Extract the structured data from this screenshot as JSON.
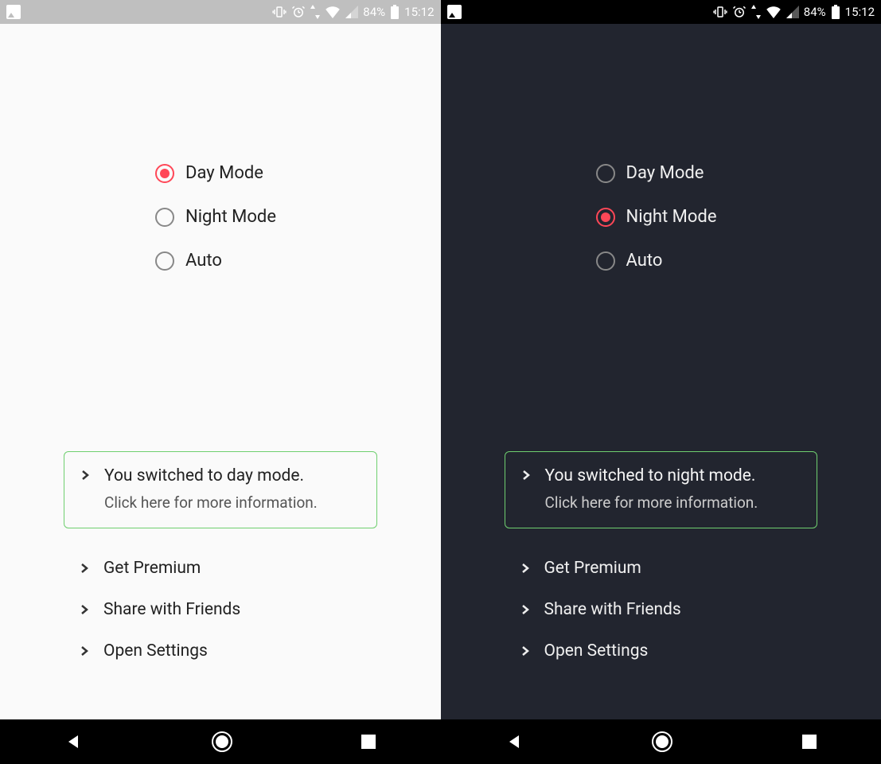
{
  "status": {
    "battery_pct": "84%",
    "time": "15:12"
  },
  "modes": {
    "day": "Day Mode",
    "night": "Night Mode",
    "auto": "Auto"
  },
  "notice": {
    "day_line1": "You switched to day mode.",
    "night_line1": "You switched to night mode.",
    "line2": "Click here for more information."
  },
  "links": {
    "premium": "Get Premium",
    "share": "Share with Friends",
    "settings": "Open Settings"
  },
  "colors": {
    "accent_radio": "#ff4757",
    "notice_border": "#6fcf6f",
    "dark_bg": "#22252f",
    "light_bg": "#fafafa"
  }
}
